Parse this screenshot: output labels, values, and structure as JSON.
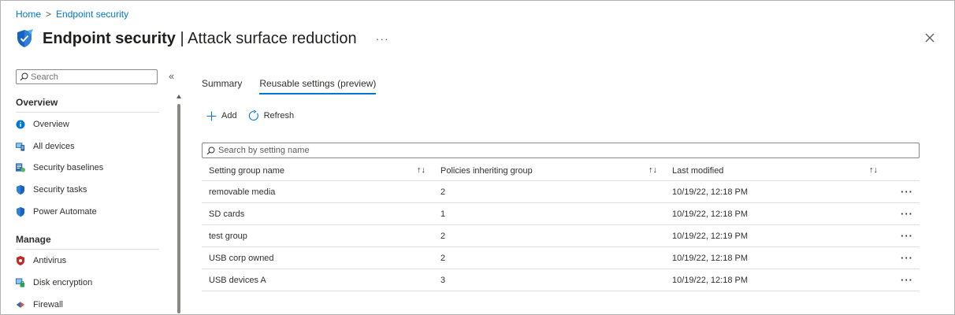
{
  "breadcrumb": {
    "home": "Home",
    "separator": ">",
    "current": "Endpoint security"
  },
  "header": {
    "title_main": "Endpoint security",
    "title_rest": " | Attack surface reduction",
    "more": "···",
    "icon": "shield-check-icon"
  },
  "sidebar": {
    "search_placeholder": "Search",
    "collapse": "«",
    "sections": [
      {
        "title": "Overview",
        "items": [
          {
            "label": "Overview",
            "icon": "info-icon"
          },
          {
            "label": "All devices",
            "icon": "devices-icon"
          },
          {
            "label": "Security baselines",
            "icon": "baseline-icon"
          },
          {
            "label": "Security tasks",
            "icon": "shield-icon"
          },
          {
            "label": "Power Automate",
            "icon": "shield-icon"
          }
        ]
      },
      {
        "title": "Manage",
        "items": [
          {
            "label": "Antivirus",
            "icon": "antivirus-icon"
          },
          {
            "label": "Disk encryption",
            "icon": "disk-encryption-icon"
          },
          {
            "label": "Firewall",
            "icon": "firewall-icon"
          }
        ]
      }
    ]
  },
  "tabs": [
    {
      "label": "Summary",
      "active": false
    },
    {
      "label": "Reusable settings (preview)",
      "active": true
    }
  ],
  "toolbar": {
    "add_label": "Add",
    "refresh_label": "Refresh"
  },
  "grid": {
    "search_placeholder": "Search by setting name",
    "columns": [
      "Setting group name",
      "Policies inheriting group",
      "Last modified"
    ],
    "sort_glyph": "↑↓",
    "row_menu": "···",
    "rows": [
      {
        "name": "removable media",
        "policies": "2",
        "modified": "10/19/22, 12:18 PM"
      },
      {
        "name": "SD cards",
        "policies": "1",
        "modified": "10/19/22, 12:18 PM"
      },
      {
        "name": "test group",
        "policies": "2",
        "modified": "10/19/22, 12:19 PM"
      },
      {
        "name": "USB corp owned",
        "policies": "2",
        "modified": "10/19/22, 12:18 PM"
      },
      {
        "name": "USB devices A",
        "policies": "3",
        "modified": "10/19/22, 12:18 PM"
      }
    ]
  },
  "colors": {
    "accent": "#0078d4",
    "text": "#323130",
    "border": "#e1dfdd"
  }
}
